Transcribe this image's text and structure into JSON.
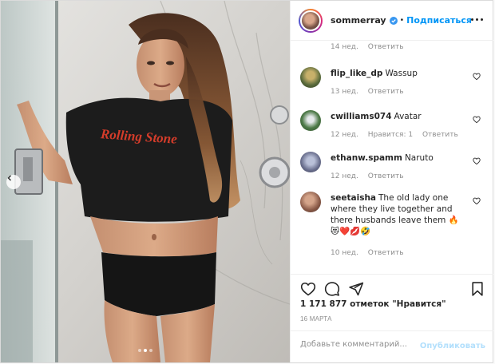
{
  "post": {
    "username": "sommerray",
    "separator": "•",
    "follow_label": "Подписаться",
    "verified_color": "#3897f0"
  },
  "photo": {
    "shirt_text": "Rolling Stone",
    "slides_total": 3,
    "slides_active": 2
  },
  "comments": {
    "top_meta": {
      "time": "14 нед.",
      "reply": "Ответить"
    },
    "items": [
      {
        "user": "flip_like_dp",
        "text": "Wassup",
        "time": "13 нед.",
        "likes": "",
        "reply": "Ответить",
        "avatar_color": "#5a6b3c"
      },
      {
        "user": "cwilliams074",
        "text": "Avatar",
        "time": "12 нед.",
        "likes": "Нравится: 1",
        "reply": "Ответить",
        "avatar_color": "#4d7a48"
      },
      {
        "user": "ethanw.spamm",
        "text": "Naruto",
        "time": "12 нед.",
        "likes": "",
        "reply": "Ответить",
        "avatar_color": "#6a6f8e"
      },
      {
        "user": "seetaisha",
        "text": "The old lady one where they live together and there husbands leave them 🔥😻❤️💋🤣",
        "time": "10 нед.",
        "likes": "",
        "reply": "Ответить",
        "avatar_color": "#8a5a48"
      }
    ]
  },
  "actions": {
    "likes_text": "1 171 877 отметок \"Нравится\"",
    "date": "16 МАРТА"
  },
  "add_comment": {
    "placeholder": "Добавьте комментарий...",
    "value": "",
    "publish_label": "Опубликовать"
  }
}
